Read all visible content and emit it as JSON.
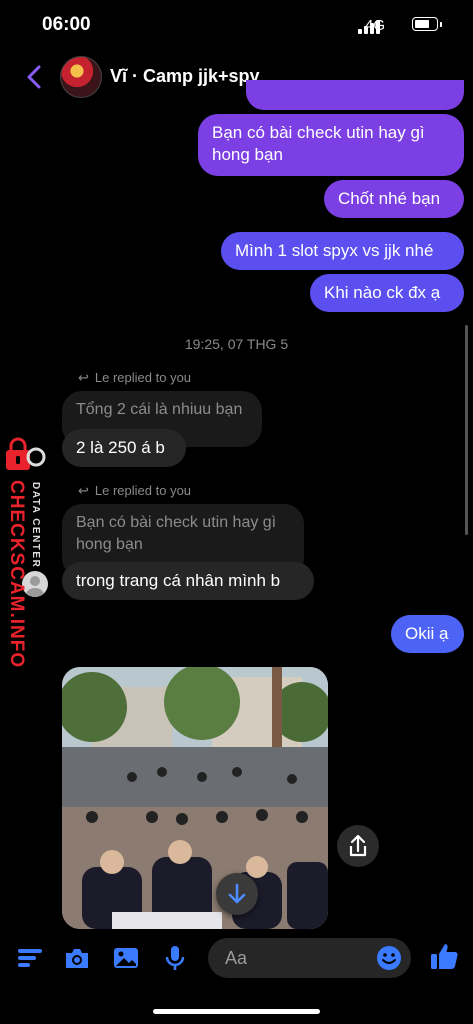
{
  "status": {
    "time": "06:00",
    "network": "4G",
    "battery_percent": 55
  },
  "header": {
    "title": "Vĩ · Camp jjk+spy"
  },
  "messages": {
    "out1": "Bạn có bài check utin hay gì hong bạn",
    "out2": "Chốt nhé bạn",
    "out3": "Mình 1 slot spyx vs jjk nhé",
    "out4": "Khi nào ck đx ạ",
    "timestamp": "19:25, 07 THG 5",
    "reply_note_1": "Le replied to you",
    "quoted_1": "Tổng 2 cái là nhiuu bạn",
    "in1": "2 là 250 á b",
    "reply_note_2": "Le replied to you",
    "quoted_2": "Bạn có bài check utin hay gì hong bạn",
    "in2": "trong trang cá nhân mình b",
    "out5": "Okii ạ"
  },
  "watermark": {
    "brand": "CHECKSCAM.INFO",
    "sub": "DATA CENTER"
  },
  "composer": {
    "placeholder": "Aa"
  },
  "colors": {
    "accent": "#4d63f5",
    "outgoing_top": "#7b3fe4",
    "incoming": "#262626",
    "brand_red": "#e8232b"
  },
  "icons": [
    "chevron-left-icon",
    "menu-icon",
    "camera-icon",
    "image-icon",
    "microphone-icon",
    "emoji-icon",
    "thumbs-up-icon",
    "share-icon",
    "arrow-down-icon",
    "reply-icon",
    "lock-icon"
  ]
}
